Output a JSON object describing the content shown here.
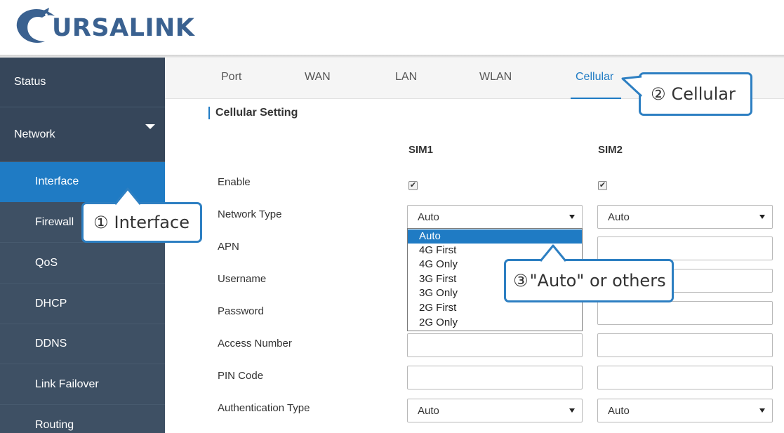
{
  "brand": {
    "name": "URSALINK",
    "color": "#3a6190"
  },
  "colors": {
    "accent": "#1f7bc4",
    "sidebar": "#3b4c5f",
    "callout_border": "#2d7fc2"
  },
  "sidebar": {
    "items": [
      {
        "label": "Status"
      },
      {
        "label": "Network",
        "expanded": true
      },
      {
        "label": "Interface",
        "active": true
      },
      {
        "label": "Firewall"
      },
      {
        "label": "QoS"
      },
      {
        "label": "DHCP"
      },
      {
        "label": "DDNS"
      },
      {
        "label": "Link Failover"
      },
      {
        "label": "Routing"
      }
    ]
  },
  "tabs": [
    {
      "label": "Port"
    },
    {
      "label": "WAN"
    },
    {
      "label": "LAN"
    },
    {
      "label": "WLAN"
    },
    {
      "label": "Cellular",
      "active": true
    }
  ],
  "section": {
    "title": "Cellular Setting",
    "columns": [
      "SIM1",
      "SIM2"
    ],
    "rows": {
      "enable": {
        "label": "Enable",
        "sim1_checked": true,
        "sim2_checked": true,
        "check_mark": "✔"
      },
      "network_type": {
        "label": "Network Type",
        "sim1": "Auto",
        "sim2": "Auto"
      },
      "apn": {
        "label": "APN",
        "sim1": "",
        "sim2": ""
      },
      "username": {
        "label": "Username",
        "sim1": "",
        "sim2": ""
      },
      "password": {
        "label": "Password",
        "sim1": "",
        "sim2": ""
      },
      "access_number": {
        "label": "Access Number",
        "sim1": "",
        "sim2": ""
      },
      "pin_code": {
        "label": "PIN Code",
        "sim1": "",
        "sim2": ""
      },
      "auth_type": {
        "label": "Authentication Type",
        "sim1": "Auto",
        "sim2": "Auto"
      }
    }
  },
  "network_type_options": [
    "Auto",
    "4G First",
    "4G Only",
    "3G First",
    "3G Only",
    "2G First",
    "2G Only"
  ],
  "callouts": {
    "interface": {
      "num": "①",
      "text": "Interface"
    },
    "cellular": {
      "num": "②",
      "text": "Cellular"
    },
    "auto": {
      "num": "③",
      "text": "\"Auto\" or others"
    }
  }
}
